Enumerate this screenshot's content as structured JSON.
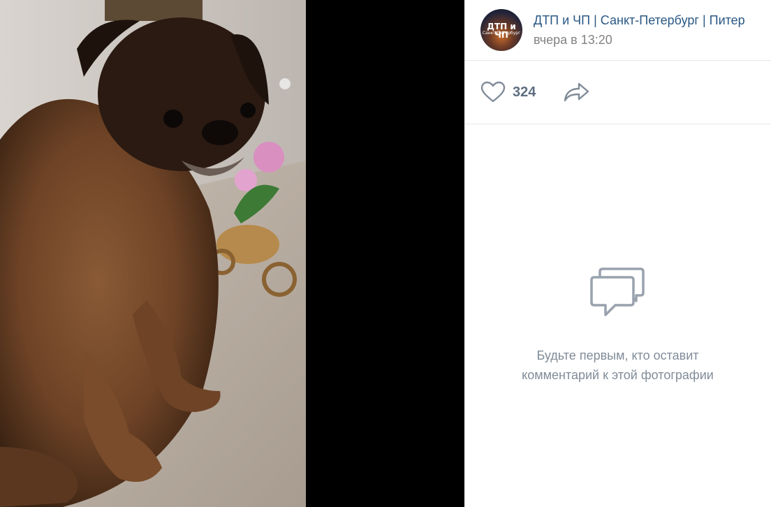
{
  "post": {
    "owner_name": "ДТП и ЧП | Санкт-Петербург | Питер",
    "avatar_title": "ДТП и ЧП",
    "avatar_subtitle": "Санкт-Петербург",
    "date": "вчера в 13:20"
  },
  "actions": {
    "likes_count": "324",
    "like_icon": "heart-icon",
    "share_icon": "share-arrow-icon"
  },
  "comments": {
    "empty_icon": "comments-bubble-icon",
    "empty_text": "Будьте первым, кто оставит комментарий к этой фотографии"
  },
  "colors": {
    "link": "#2a5885",
    "muted": "#828282",
    "icon": "#818c99",
    "viewer_bg": "#000000"
  }
}
